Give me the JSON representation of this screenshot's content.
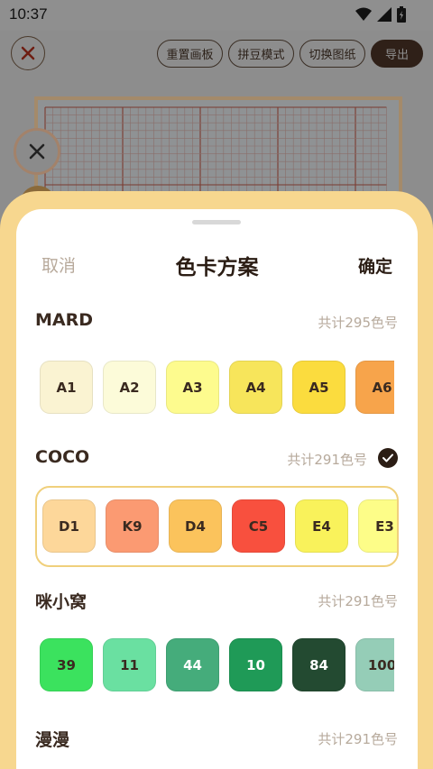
{
  "status_bar": {
    "time": "10:37"
  },
  "toolbar": {
    "reset_label": "重置画板",
    "bead_mode_label": "拼豆模式",
    "switch_image_label": "切换图纸",
    "export_label": "导出"
  },
  "sheet": {
    "cancel_label": "取消",
    "title": "色卡方案",
    "confirm_label": "确定",
    "schemes": [
      {
        "name": "MARD",
        "count": "共计295色号",
        "selected": false,
        "swatches": [
          {
            "code": "A1",
            "color": "#faf3d2"
          },
          {
            "code": "A2",
            "color": "#fcfbd9"
          },
          {
            "code": "A3",
            "color": "#fdfb8e"
          },
          {
            "code": "A4",
            "color": "#f7e55b"
          },
          {
            "code": "A5",
            "color": "#fbdc3e"
          },
          {
            "code": "A6",
            "color": "#f7a44b"
          }
        ]
      },
      {
        "name": "COCO",
        "count": "共计291色号",
        "selected": true,
        "swatches": [
          {
            "code": "D1",
            "color": "#fdd79a"
          },
          {
            "code": "K9",
            "color": "#fb9a72"
          },
          {
            "code": "D4",
            "color": "#fbc35c"
          },
          {
            "code": "C5",
            "color": "#f8503e"
          },
          {
            "code": "E4",
            "color": "#f9f25b"
          },
          {
            "code": "E3",
            "color": "#fdfd88"
          }
        ]
      },
      {
        "name": "咪小窝",
        "count": "共计291色号",
        "selected": false,
        "swatches": [
          {
            "code": "39",
            "color": "#3be25e"
          },
          {
            "code": "11",
            "color": "#6ae0a1"
          },
          {
            "code": "44",
            "color": "#45ac7b"
          },
          {
            "code": "10",
            "color": "#1f9a57"
          },
          {
            "code": "84",
            "color": "#234a31"
          },
          {
            "code": "100",
            "color": "#95cdb7"
          }
        ]
      },
      {
        "name": "漫漫",
        "count": "共计291色号",
        "selected": false,
        "swatches": []
      }
    ]
  },
  "colors": {
    "accent": "#f7d78f",
    "dark": "#2b1d14",
    "muted": "#b7aa9c"
  }
}
